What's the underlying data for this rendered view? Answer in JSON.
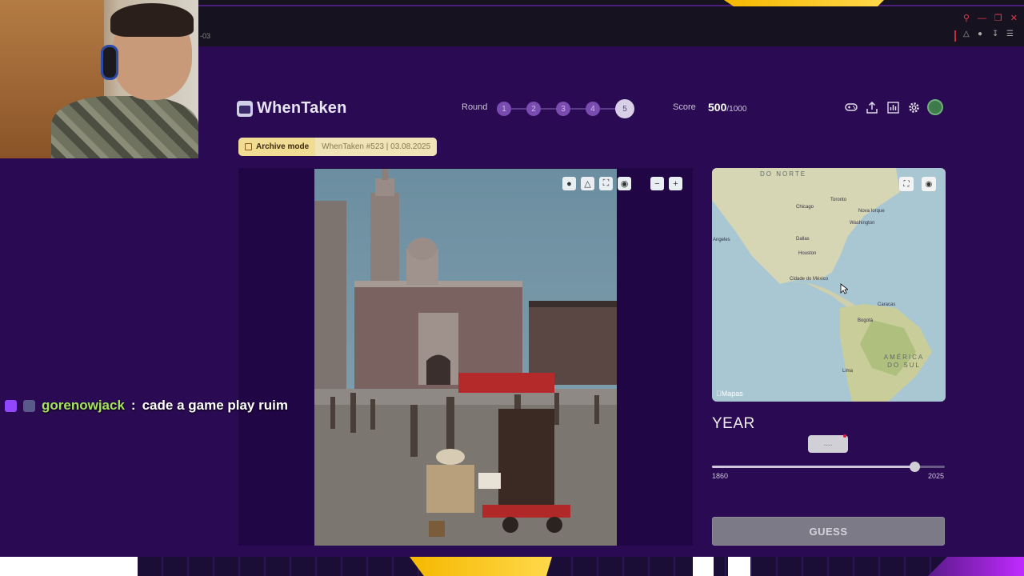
{
  "browser": {
    "url_fragment": "-03"
  },
  "app": {
    "logo_text": "WhenTaken"
  },
  "round": {
    "label": "Round",
    "items": [
      "1",
      "2",
      "3",
      "4",
      "5"
    ],
    "current": "5"
  },
  "score": {
    "label": "Score",
    "value": "500",
    "max": "/1000"
  },
  "header_icons": [
    "gamepad-icon",
    "share-icon",
    "stats-icon",
    "gear-icon",
    "avatar"
  ],
  "archive": {
    "mode_label": "Archive mode",
    "info": "WhenTaken #523 | 03.08.2025"
  },
  "photo_tools": [
    "bulb-icon",
    "warning-icon",
    "expand-icon",
    "focus-icon",
    "zoom-out-icon",
    "zoom-in-icon"
  ],
  "map": {
    "labels": {
      "north_region": "DO NORTE",
      "toronto": "Toronto",
      "chicago": "Chicago",
      "new_york": "Nova Iorque",
      "washington": "Washington",
      "los_angeles": "Angeles",
      "dallas": "Dallas",
      "houston": "Houston",
      "mexico_city": "Cidade do México",
      "caracas": "Caracas",
      "bogota": "Bogotá",
      "south_america": "AMÉRICA DO SUL",
      "lima": "Lima"
    },
    "attribution": "Mapas"
  },
  "year": {
    "title": "YEAR",
    "input_value": "....",
    "slider_min": "1860",
    "slider_max": "2025",
    "slider_fraction": 0.87
  },
  "guess_button": "GUESS",
  "chat": {
    "username": "gorenowjack",
    "separator": ":",
    "message": "cade a game play ruim"
  },
  "colors": {
    "background": "#2a0a52",
    "archive_banner": "#e8d38d",
    "round_dot": "#7a4bb0",
    "chat_username": "#a4e35c"
  }
}
